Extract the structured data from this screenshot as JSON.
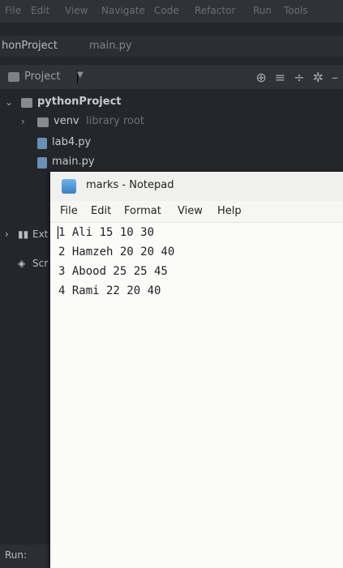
{
  "ide": {
    "menu_items": [
      "File",
      "Edit",
      "View",
      "Navigate",
      "Code",
      "Refactor",
      "Run",
      "Tools"
    ],
    "breadcrumb": {
      "project": "honProject",
      "file": "main.py"
    },
    "project_panel": {
      "label": "Project"
    },
    "tree": {
      "root": "pythonProject",
      "venv": "venv",
      "venv_hint": "library root",
      "file1": "lab4.py",
      "file2": "main.py",
      "external": "Ext",
      "scratches": "Scr"
    },
    "run_label": "Run:"
  },
  "notepad": {
    "title": "marks - Notepad",
    "menu": [
      "File",
      "Edit",
      "Format",
      "View",
      "Help"
    ],
    "lines": [
      "1 Ali 15 10 30",
      "2 Hamzeh 20 20 40",
      "3 Abood 25 25 45",
      "4 Rami 22 20 40"
    ]
  }
}
